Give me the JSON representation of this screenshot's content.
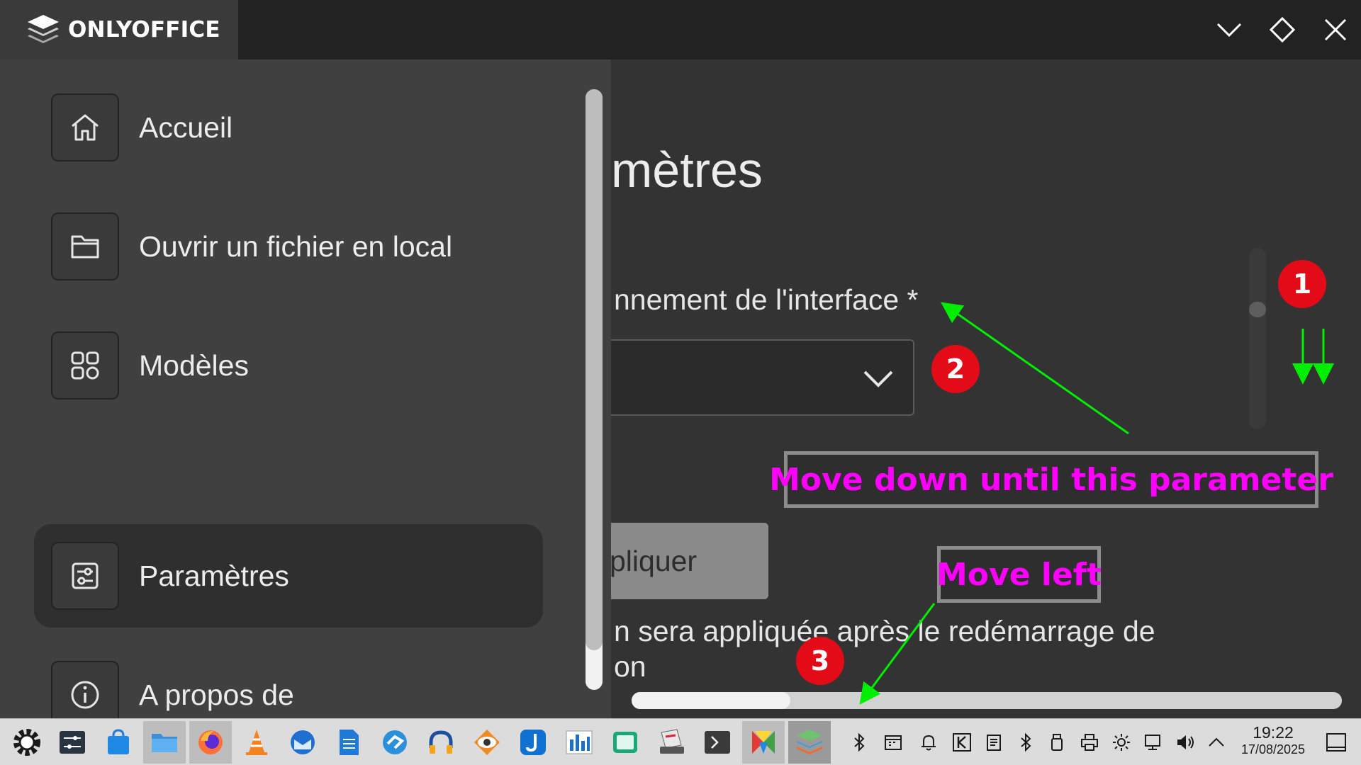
{
  "app": {
    "name": "ONLYOFFICE"
  },
  "sidebar": {
    "items": [
      {
        "label": "Accueil",
        "icon": "home-icon"
      },
      {
        "label": "Ouvrir un fichier en local",
        "icon": "folder-icon"
      },
      {
        "label": "Modèles",
        "icon": "grid-icon"
      },
      {
        "label": "Paramètres",
        "icon": "settings-icon",
        "active": true
      },
      {
        "label": "A propos de",
        "icon": "info-icon"
      }
    ]
  },
  "settings": {
    "title_fragment": "mètres",
    "field_label_fragment": "nnement de l'interface *",
    "apply_label_fragment": "pliquer",
    "note_line1_fragment": "n sera appliquée après le redémarrage de",
    "note_line2_fragment": "on"
  },
  "annotations": {
    "badges": [
      "1",
      "2",
      "3"
    ],
    "callout_down": "Move down until this parameter",
    "callout_left": "Move left",
    "arrow_color": "#00ee00",
    "text_color": "#ff00ff",
    "badge_color": "#e30b17"
  },
  "taskbar": {
    "time": "19:22",
    "date": "17/08/2025"
  }
}
